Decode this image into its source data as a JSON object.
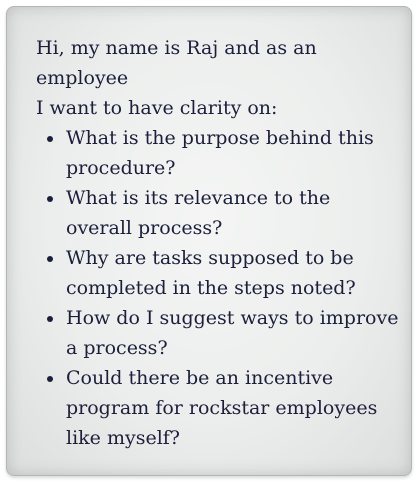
{
  "intro": {
    "line1": "Hi, my name is Raj and as an employee",
    "line2": "I want to have clarity on:"
  },
  "questions": [
    "What is the purpose behind this procedure?",
    "What is its relevance to the overall process?",
    "Why are tasks supposed to be completed in the steps noted?",
    "How do I suggest ways to improve a process?",
    "Could there be an incentive program for rockstar employees like myself?"
  ],
  "colors": {
    "text": "#1b1f3a",
    "card_background": "#eceeed",
    "card_border": "#b4b6b5"
  }
}
